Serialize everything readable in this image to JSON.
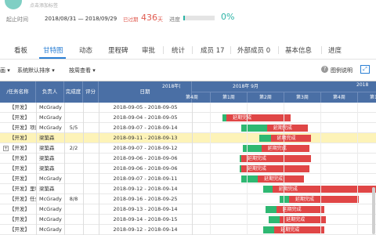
{
  "header": {
    "subtitle": "点击添加标签",
    "start_label": "起止时间",
    "date_range": "2018/08/31 — 2018/09/29",
    "overdue_badge": "已过期",
    "overdue_days": "436",
    "overdue_unit": "天",
    "progress_label": "进度",
    "progress_value": 0.05,
    "progress_text": "0%"
  },
  "tabs": [
    {
      "label": "看板"
    },
    {
      "label": "甘特图"
    },
    {
      "label": "动态"
    },
    {
      "label": "里程碑"
    },
    {
      "label": "审批"
    },
    {
      "label": "统计"
    },
    {
      "label": "成员 17"
    },
    {
      "label": "外部成员 0"
    },
    {
      "label": "基本信息"
    },
    {
      "label": "进度"
    }
  ],
  "toolbar": {
    "filter_suffix": "画 ▾",
    "sort_label": "系统默认排序 ▾",
    "view_label": "按周查看 ▾",
    "legend_label": "图例说明"
  },
  "grid": {
    "columns": [
      "/任务名称",
      "负责人",
      "完成度",
      "评分",
      "日期"
    ],
    "gantt_top": [
      "2018年(",
      "2018年 9月",
      "2018"
    ],
    "gantt_weeks": [
      "第4周",
      "第1周",
      "第2周",
      "第3周",
      "第4周",
      "第1周",
      "第2周"
    ],
    "bar_label": "延期完成",
    "rows": [
      {
        "name": "【开发】",
        "owner": "McGrady",
        "done": "",
        "score": "",
        "date": "2018-09-05 - 2018-09-05",
        "expander": false,
        "highlight": false,
        "bar": null
      },
      {
        "name": "【开发】",
        "owner": "McGrady",
        "done": "",
        "score": "",
        "date": "2018-09-04 - 2018-09-05",
        "expander": false,
        "highlight": false,
        "bar": {
          "start": 1.35,
          "green": 0.1,
          "red": 1.75
        }
      },
      {
        "name": "【开发】项目",
        "owner": "McGrady",
        "done": "5/5",
        "score": "",
        "date": "2018-09-07 - 2018-09-14",
        "expander": false,
        "highlight": false,
        "bar": {
          "start": 1.85,
          "green": 0.7,
          "red": 1.1
        }
      },
      {
        "name": "【开发】",
        "owner": "梁築森",
        "done": "",
        "score": "",
        "date": "2018-09-11 - 2018-09-13",
        "expander": false,
        "highlight": true,
        "bar": {
          "start": 2.35,
          "green": 0.3,
          "red": 1.1
        }
      },
      {
        "name": "【开发】",
        "owner": "梁築森",
        "done": "2/2",
        "score": "",
        "date": "2018-09-07 - 2018-09-12",
        "expander": true,
        "highlight": false,
        "bar": {
          "start": 1.9,
          "green": 0.5,
          "red": 1.3
        }
      },
      {
        "name": "【开发】",
        "owner": "梁築森",
        "done": "",
        "score": "",
        "date": "2018-09-06 - 2018-09-06",
        "expander": false,
        "highlight": false,
        "bar": {
          "start": 1.8,
          "green": 0.05,
          "red": 1.9
        }
      },
      {
        "name": "【开发】",
        "owner": "梁築森",
        "done": "",
        "score": "",
        "date": "2018-09-06 - 2018-09-06",
        "expander": false,
        "highlight": false,
        "bar": {
          "start": 1.8,
          "green": 0.05,
          "red": 1.85
        }
      },
      {
        "name": "【开发】",
        "owner": "McGrady",
        "done": "",
        "score": "",
        "date": "2018-09-07 - 2018-09-11",
        "expander": false,
        "highlight": false,
        "bar": {
          "start": 1.85,
          "green": 0.45,
          "red": 1.25
        }
      },
      {
        "name": "【开发】里程",
        "owner": "梁築森",
        "done": "",
        "score": "",
        "date": "2018-09-12 - 2018-09-14",
        "expander": false,
        "highlight": false,
        "bar": {
          "start": 2.45,
          "green": 0.25,
          "red": 2.9
        }
      },
      {
        "name": "【开发】任务",
        "owner": "McGrady",
        "done": "8/8",
        "score": "",
        "date": "2018-09-16 - 2018-09-25",
        "expander": false,
        "highlight": false,
        "bar": {
          "start": 2.9,
          "green": 0.25,
          "red": 1.9
        }
      },
      {
        "name": "【开发】",
        "owner": "McGrady",
        "done": "",
        "score": "",
        "date": "2018-09-13 - 2018-09-14",
        "expander": false,
        "highlight": false,
        "bar": {
          "start": 2.5,
          "green": 0.3,
          "red": 1.3
        }
      },
      {
        "name": "【开发】",
        "owner": "McGrady",
        "done": "",
        "score": "",
        "date": "2018-09-14 - 2018-09-15",
        "expander": false,
        "highlight": false,
        "bar": {
          "start": 2.6,
          "green": 0.3,
          "red": 1.25
        }
      },
      {
        "name": "【开发】",
        "owner": "McGrady",
        "done": "",
        "score": "",
        "date": "2018-09-12 - 2018-09-14",
        "expander": false,
        "highlight": false,
        "bar": {
          "start": 2.45,
          "green": 0.3,
          "red": 1.35
        }
      }
    ]
  },
  "colors": {
    "accent": "#2a7fd4",
    "teal": "#2bb3a5",
    "overdue": "#e05a4f",
    "header_bg": "#4a6fa5",
    "bar_green": "#2eb872",
    "bar_red": "#e04646",
    "highlight_row": "#fdf3b8"
  }
}
